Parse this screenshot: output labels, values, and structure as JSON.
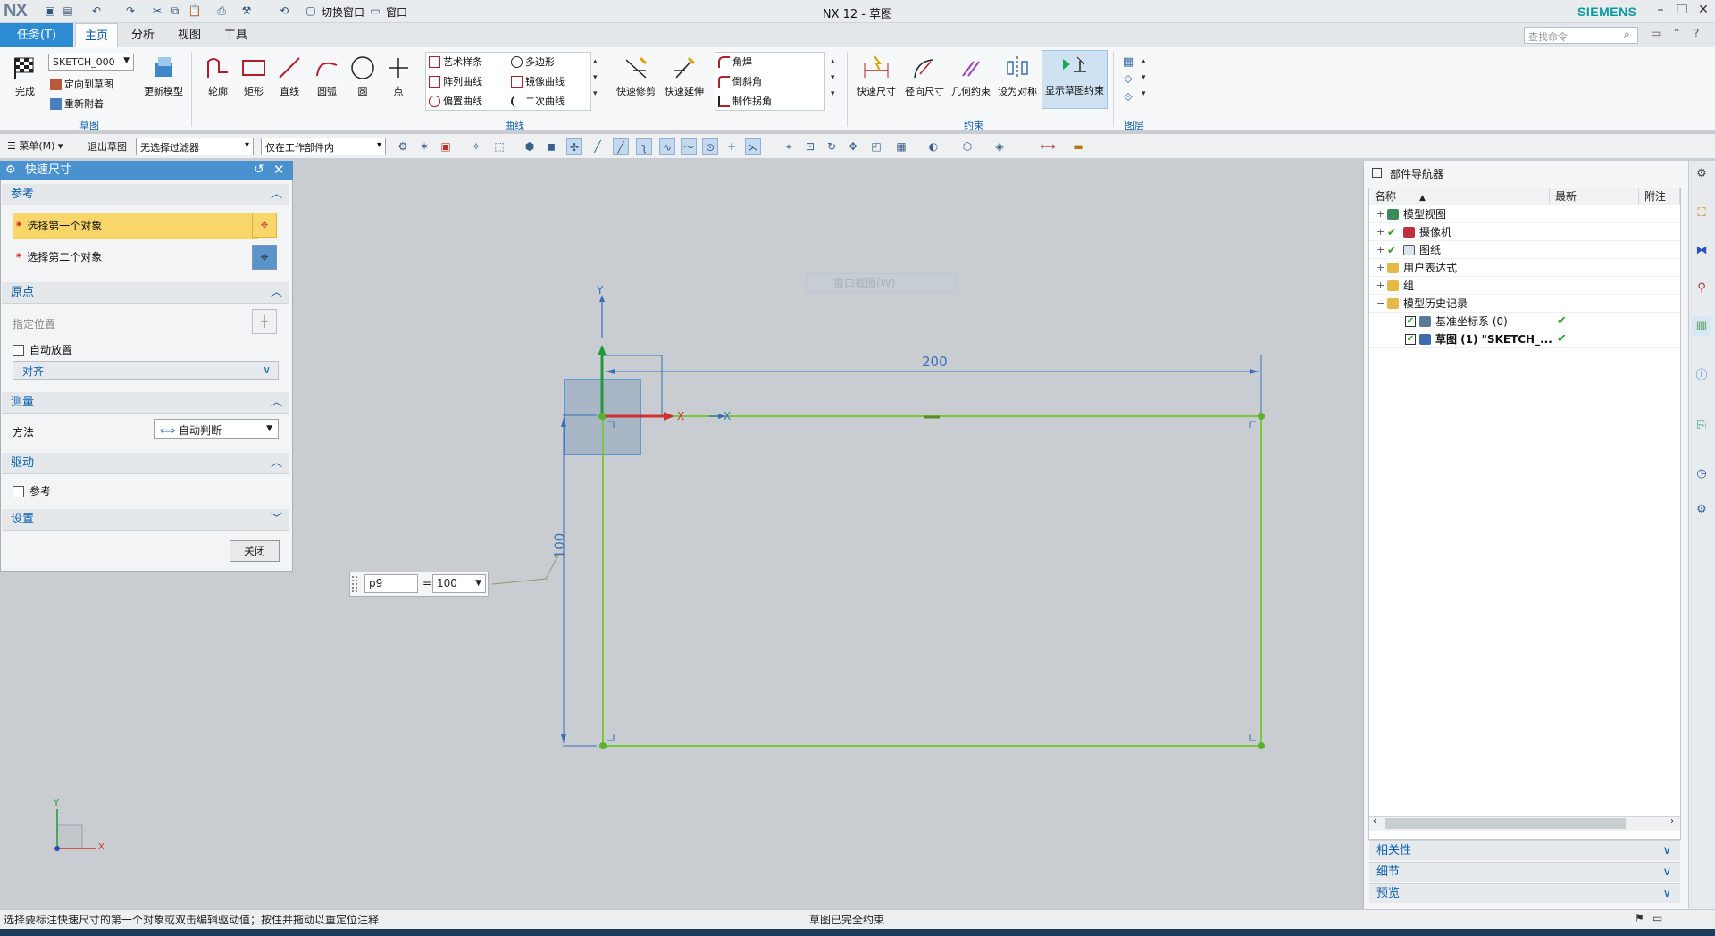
{
  "window": {
    "app_logo": "NX",
    "title": "NX 12 - 草图",
    "brand": "SIEMENS",
    "quick_switch_window": "切换窗口",
    "quick_window_menu": "窗口"
  },
  "tabs": [
    {
      "label": "任务(T)"
    },
    {
      "label": "主页"
    },
    {
      "label": "分析"
    },
    {
      "label": "视图"
    },
    {
      "label": "工具"
    }
  ],
  "search": {
    "placeholder": "查找命令"
  },
  "ribbon": {
    "sketch_group": {
      "finish": "完成",
      "sketch_name": "SKETCH_000",
      "orient": "定向到草图",
      "reattach": "重新附着",
      "update_model": "更新模型",
      "label": "草图"
    },
    "curve_group": {
      "profile": "轮廓",
      "rectangle": "矩形",
      "line": "直线",
      "arc": "圆弧",
      "circle": "圆",
      "point": "点",
      "art_spline": "艺术样条",
      "polygon": "多边形",
      "pattern_curve": "阵列曲线",
      "mirror_curve": "镜像曲线",
      "offset_curve": "偏置曲线",
      "conic": "二次曲线",
      "quick_trim": "快速修剪",
      "quick_extend": "快速延伸",
      "fillet": "角焊",
      "chamfer": "倒斜角",
      "make_corner": "制作拐角",
      "label": "曲线"
    },
    "constraint_group": {
      "rapid_dim": "快速尺寸",
      "radial_dim": "径向尺寸",
      "geom_constraint": "几何约束",
      "make_symmetric": "设为对称",
      "show_constraints": "显示草图约束",
      "label": "约束"
    },
    "layer_group": {
      "label": "图层"
    }
  },
  "toolbar2": {
    "menu": "菜单(M)",
    "exit_sketch": "退出草图",
    "filter": "无选择过滤器",
    "scope": "仅在工作部件内"
  },
  "dialog": {
    "title": "快速尺寸",
    "ref_section": "参考",
    "first_object": "选择第一个对象",
    "second_object": "选择第二个对象",
    "origin_section": "原点",
    "specify_location": "指定位置",
    "auto_place": "自动放置",
    "align": "对齐",
    "measure_section": "测量",
    "method_label": "方法",
    "method_value": "自动判断",
    "driving_section": "驱动",
    "reference_chk": "参考",
    "settings_section": "设置",
    "close": "关闭"
  },
  "canvas": {
    "dim_horizontal": "200",
    "dim_vertical": "100",
    "axis_x": "X",
    "axis_y": "Y",
    "axis_x2": "X",
    "triad_x": "X",
    "triad_y": "Y",
    "hint": "窗口截图(W)",
    "input": {
      "name": "p9",
      "eq": "=",
      "value": "100"
    }
  },
  "navigator": {
    "title": "部件导航器",
    "col_name": "名称",
    "col_latest": "最新",
    "col_note": "附注",
    "rows": [
      {
        "label": "模型视图"
      },
      {
        "label": "摄像机"
      },
      {
        "label": "图纸"
      },
      {
        "label": "用户表达式"
      },
      {
        "label": "组"
      },
      {
        "label": "模型历史记录"
      },
      {
        "label": "基准坐标系 (0)"
      },
      {
        "label": "草图 (1) \"SKETCH_..."
      }
    ],
    "sections": [
      "相关性",
      "细节",
      "预览"
    ]
  },
  "status": {
    "left": "选择要标注快速尺寸的第一个对象或双击编辑驱动值；按住并拖动以重定位注释",
    "center": "草图已完全约束"
  },
  "colors": {
    "accent": "#2d8bd1",
    "sketch": "#78c83a",
    "dim": "#3a6fb8"
  }
}
